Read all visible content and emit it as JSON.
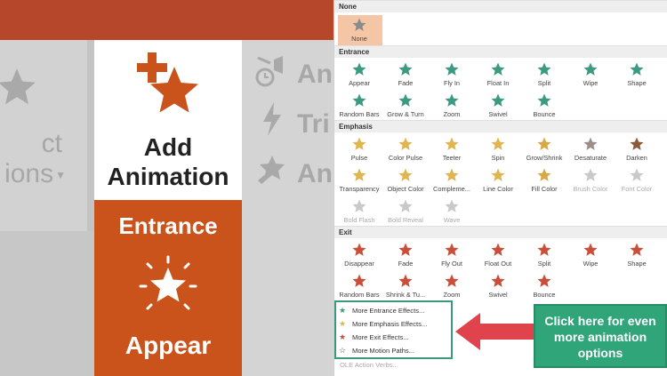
{
  "left": {
    "bigtext": {
      "l1": "ct",
      "l2": "ions"
    },
    "add_animation": {
      "line1": "Add",
      "line2": "Animation"
    },
    "entrance_label": "Entrance",
    "appear_label": "Appear",
    "grey_right": [
      "An",
      "Tri",
      "An"
    ]
  },
  "gallery": {
    "sections": [
      {
        "name": "None",
        "items": [
          {
            "label": "None"
          }
        ]
      },
      {
        "name": "Entrance",
        "items": [
          {
            "label": "Appear"
          },
          {
            "label": "Fade"
          },
          {
            "label": "Fly In"
          },
          {
            "label": "Float In"
          },
          {
            "label": "Split"
          },
          {
            "label": "Wipe"
          },
          {
            "label": "Shape"
          },
          {
            "label": "Random Bars"
          },
          {
            "label": "Grow & Turn"
          },
          {
            "label": "Zoom"
          },
          {
            "label": "Swivel"
          },
          {
            "label": "Bounce"
          }
        ]
      },
      {
        "name": "Emphasis",
        "items": [
          {
            "label": "Pulse"
          },
          {
            "label": "Color Pulse"
          },
          {
            "label": "Teeter"
          },
          {
            "label": "Spin"
          },
          {
            "label": "Grow/Shrink"
          },
          {
            "label": "Desaturate"
          },
          {
            "label": "Darken"
          },
          {
            "label": "Transparency"
          },
          {
            "label": "Object Color"
          },
          {
            "label": "Compleme..."
          },
          {
            "label": "Line Color"
          },
          {
            "label": "Fill Color"
          },
          {
            "label": "Brush Color"
          },
          {
            "label": "Font Color"
          },
          {
            "label": "Bold Flash"
          },
          {
            "label": "Bold Reveal"
          },
          {
            "label": "Wave"
          }
        ]
      },
      {
        "name": "Exit",
        "items": [
          {
            "label": "Disappear"
          },
          {
            "label": "Fade"
          },
          {
            "label": "Fly Out"
          },
          {
            "label": "Float Out"
          },
          {
            "label": "Split"
          },
          {
            "label": "Wipe"
          },
          {
            "label": "Shape"
          },
          {
            "label": "Random Bars"
          },
          {
            "label": "Shrink & Tu..."
          },
          {
            "label": "Zoom"
          },
          {
            "label": "Swivel"
          },
          {
            "label": "Bounce"
          }
        ]
      }
    ],
    "more": [
      {
        "label": "More Entrance Effects...",
        "icon": "green-star-icon"
      },
      {
        "label": "More Emphasis Effects...",
        "icon": "yellow-star-icon"
      },
      {
        "label": "More Exit Effects...",
        "icon": "red-star-icon"
      },
      {
        "label": "More Motion Paths...",
        "icon": "outline-star-icon"
      }
    ],
    "ole": "OLE Action Verbs..."
  },
  "callout": {
    "line1": "Click here for even",
    "line2": "more animation",
    "line3": "options"
  },
  "colors": {
    "entrance": "#3d9a80",
    "emphasis": "#e0b650",
    "exit": "#c8503a",
    "accent": "#c9531b",
    "callout": "#30a57a",
    "arrow": "#e0434b"
  }
}
